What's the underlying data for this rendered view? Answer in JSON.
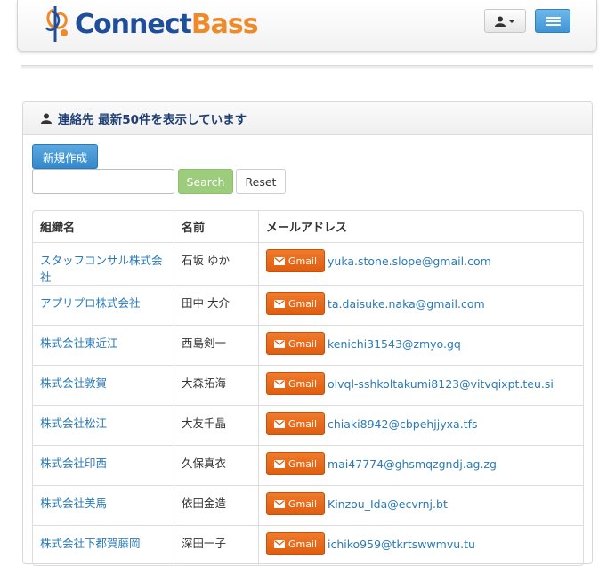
{
  "brand": {
    "connect": "Connect",
    "bass": "Bass"
  },
  "panel": {
    "title": "連絡先 最新50件を表示しています"
  },
  "toolbar": {
    "new_label": "新規作成",
    "search_value": "",
    "search_label": "Search",
    "reset_label": "Reset"
  },
  "table": {
    "headers": [
      "組織名",
      "名前",
      "メールアドレス"
    ],
    "gmail_label": "Gmail",
    "rows": [
      {
        "org": "スタッフコンサル株式会社",
        "name": "石坂 ゆか",
        "email": "yuka.stone.slope@gmail.com"
      },
      {
        "org": "アプリプロ株式会社",
        "name": "田中 大介",
        "email": "ta.daisuke.naka@gmail.com"
      },
      {
        "org": "株式会社東近江",
        "name": "西島剣一",
        "email": "kenichi31543@zmyo.gq"
      },
      {
        "org": "株式会社敦賀",
        "name": "大森拓海",
        "email": "olvql-sshkoltakumi8123@vitvqixpt.teu.si"
      },
      {
        "org": "株式会社松江",
        "name": "大友千晶",
        "email": "chiaki8942@cbpehjjyxa.tfs"
      },
      {
        "org": "株式会社印西",
        "name": "久保真衣",
        "email": "mai47774@ghsmqzgndj.ag.zg"
      },
      {
        "org": "株式会社美馬",
        "name": "依田金造",
        "email": "Kinzou_Ida@ecvrnj.bt"
      },
      {
        "org": "株式会社下都賀藤岡",
        "name": "深田一子",
        "email": "ichiko959@tkrtswwmvu.tu"
      }
    ]
  }
}
